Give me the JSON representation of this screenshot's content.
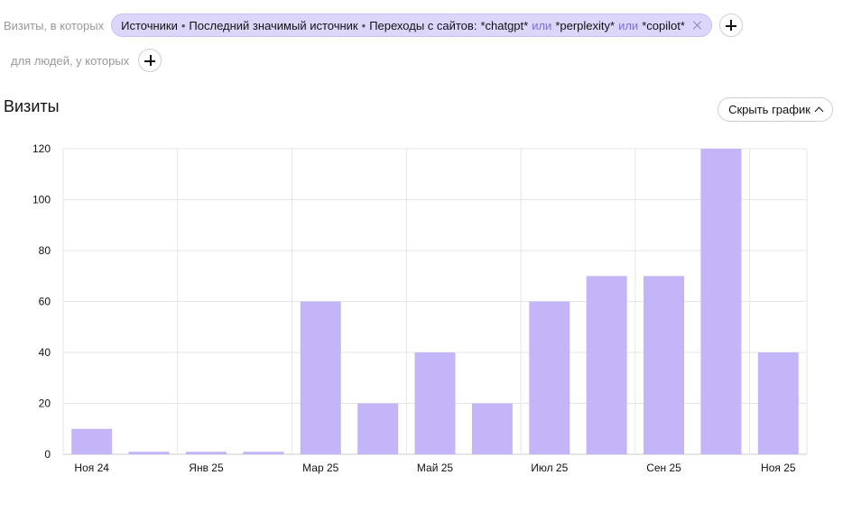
{
  "filters": {
    "visits_label": "Визиты, в которых",
    "condition": {
      "part1": "Источники",
      "part2": "Последний значимый источник",
      "part3": "Переходы с сайтов:",
      "value1": "*chatgpt*",
      "or1": "или",
      "value2": "*perplexity*",
      "or2": "или",
      "value3": "*copilot*"
    },
    "people_label": "для людей, у которых"
  },
  "header": {
    "title": "Визиты",
    "hide_chart_label": "Скрыть график"
  },
  "chart_data": {
    "type": "bar",
    "title": "",
    "xlabel": "",
    "ylabel": "",
    "ylim": [
      0,
      120
    ],
    "y_ticks": [
      0,
      20,
      40,
      60,
      80,
      100,
      120
    ],
    "categories": [
      "Ноя 24",
      "",
      "Янв 25",
      "",
      "Мар 25",
      "",
      "Май 25",
      "",
      "Июл 25",
      "",
      "Сен 25",
      "",
      "Ноя 25"
    ],
    "values": [
      10,
      1,
      1,
      1,
      60,
      20,
      40,
      20,
      60,
      70,
      70,
      120,
      40
    ],
    "bar_color": "#c4b4f8",
    "grid": true
  }
}
